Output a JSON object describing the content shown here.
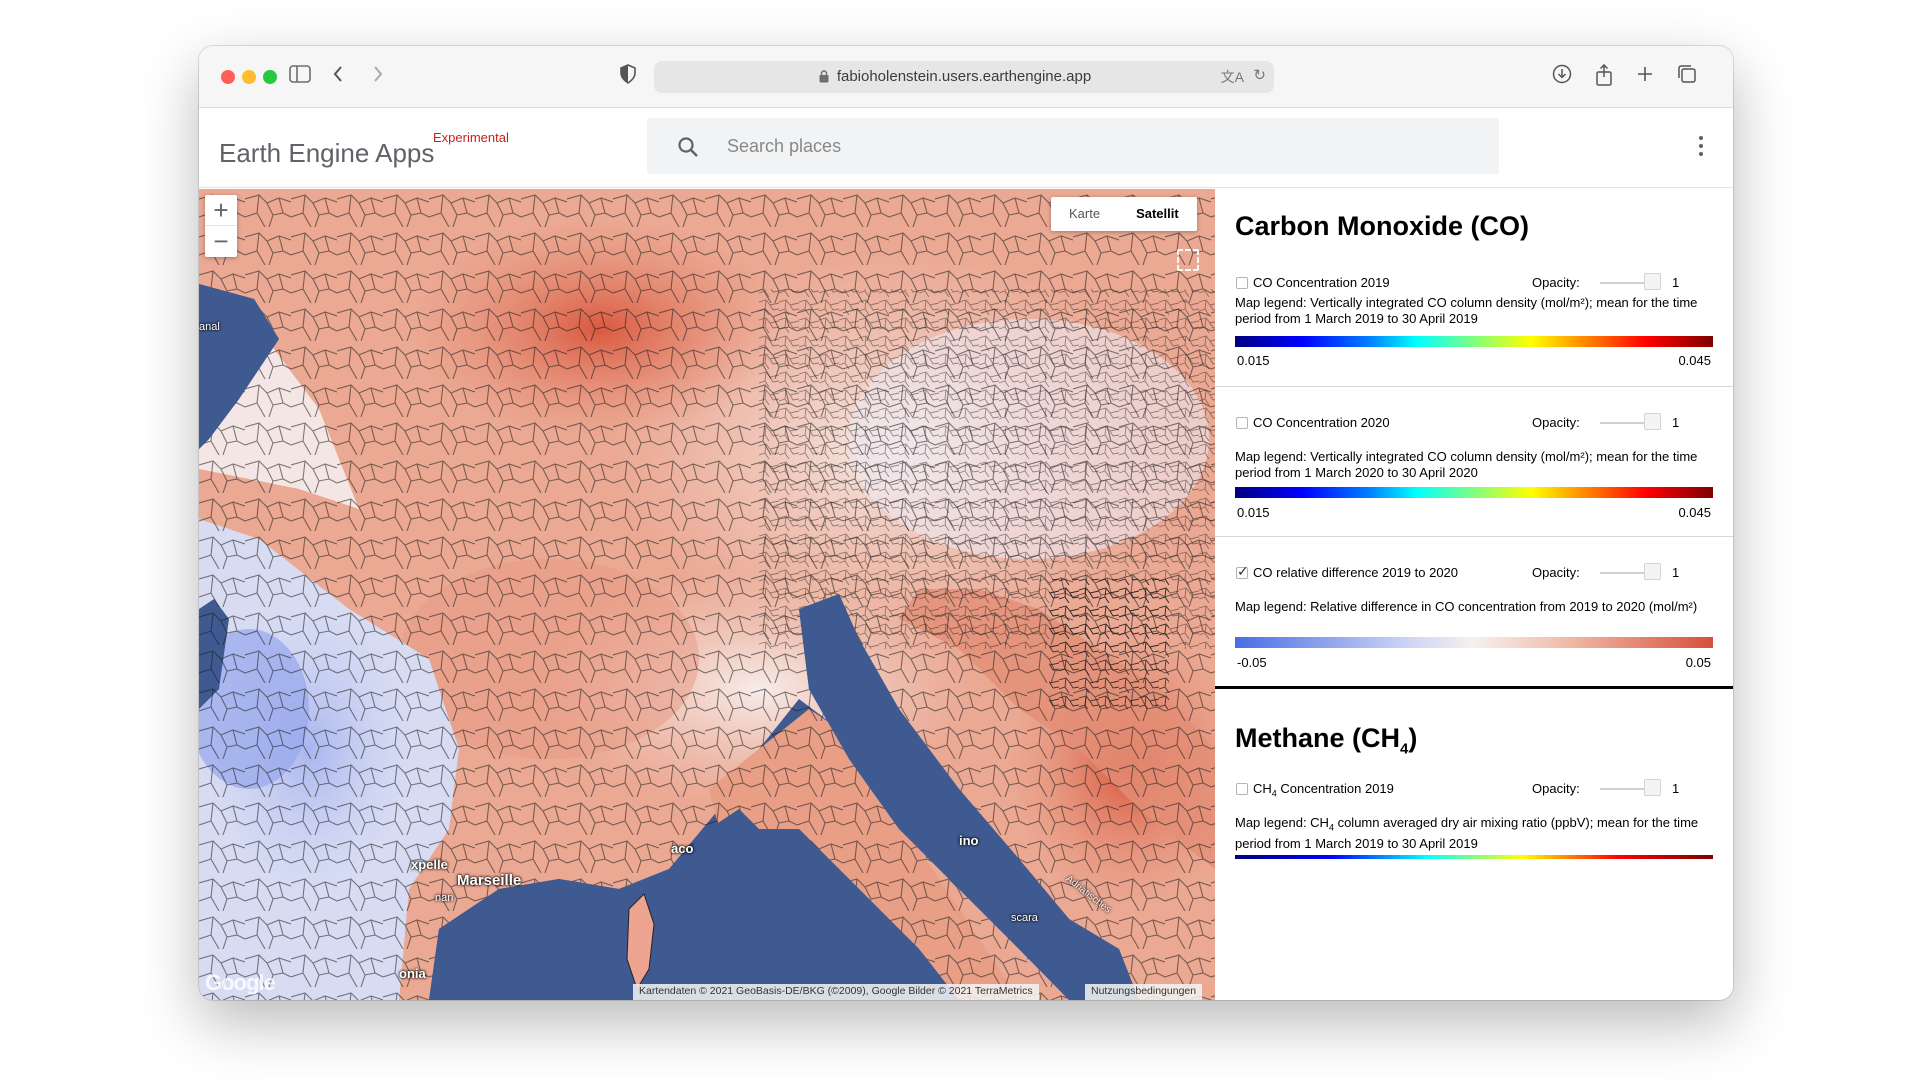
{
  "browser": {
    "url": "fabioholenstein.users.earthengine.app",
    "icons": [
      "sidebar-icon",
      "back-icon",
      "forward-icon",
      "shield-icon",
      "lock-icon",
      "translate-icon",
      "reload-icon",
      "download-icon",
      "share-icon",
      "new-tab-icon",
      "tabs-overview-icon"
    ]
  },
  "header": {
    "brand": "Earth Engine Apps",
    "badge": "Experimental",
    "search_placeholder": "Search places"
  },
  "map": {
    "zoom_in": "+",
    "zoom_out": "−",
    "map_type_options": [
      "Karte",
      "Satellit"
    ],
    "map_type_selected": "Satellit",
    "attribution": "Kartendaten © 2021 GeoBasis-DE/BKG (©2009), Google Bilder © 2021 TerraMetrics",
    "terms": "Nutzungsbedingungen",
    "google_logo": "Google",
    "labels": {
      "marseille": "Marseille",
      "naco": "aco",
      "pellier": "xpelle",
      "anal": "anal",
      "man": "nan",
      "onia": "onia",
      "rimini": "ino",
      "scara": "scara",
      "adriatic": "Adriatisches"
    }
  },
  "panel": {
    "co_title": "Carbon Monoxide (CO)",
    "opacity_label": "Opacity:",
    "layers": [
      {
        "name": "CO Concentration 2019",
        "checked": false,
        "opacity": "1",
        "legend": "Map legend: Vertically integrated CO column density (mol/m²); mean for the time period from 1 March 2019 to 30 April 2019",
        "min": "0.015",
        "max": "0.045"
      },
      {
        "name": "CO Concentration 2020",
        "checked": false,
        "opacity": "1",
        "legend": "Map legend: Vertically integrated CO column density (mol/m²); mean for the time period from 1 March 2020 to 30 April 2020",
        "min": "0.015",
        "max": "0.045"
      },
      {
        "name": "CO relative difference 2019 to 2020",
        "checked": true,
        "opacity": "1",
        "legend": "Map legend: Relative difference in CO concentration from 2019 to 2020 (mol/m²)",
        "min": "-0.05",
        "max": "0.05"
      }
    ],
    "methane_title_main": "Methane (CH",
    "methane_title_sub": "4",
    "methane_title_end": ")",
    "methane_layer": {
      "name_main": "CH",
      "name_sub": "4",
      "name_end": " Concentration 2019",
      "opacity": "1",
      "legend_main": "Map legend: CH",
      "legend_sub": "4",
      "legend_end": " column averaged dry air mixing ratio (ppbV); mean for the time period from 1 March 2019 to 30 April 2019"
    }
  },
  "colors": {
    "diff_low": "#4a6de5",
    "diff_high": "#d6503b",
    "sea": "#3f5a91",
    "experimental": "#c5221f"
  }
}
